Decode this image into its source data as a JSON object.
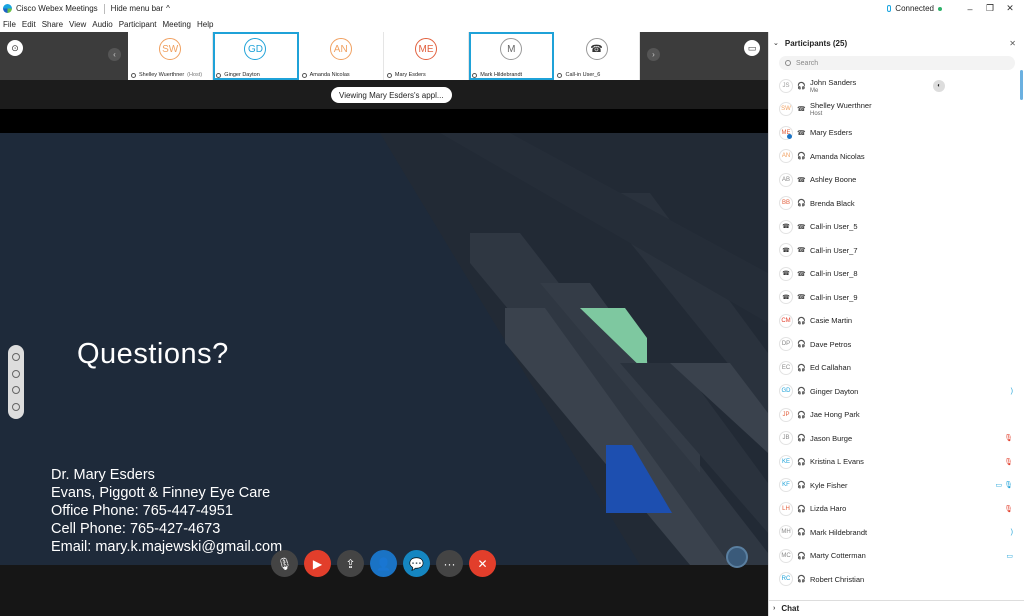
{
  "window": {
    "title": "Cisco Webex Meetings",
    "hide_menu": "Hide menu bar",
    "hide_menu_arrow": "^",
    "status": "Connected",
    "btn_min": "–",
    "btn_max": "❐",
    "btn_close": "✕"
  },
  "menu": [
    "File",
    "Edit",
    "Share",
    "View",
    "Audio",
    "Participant",
    "Meeting",
    "Help"
  ],
  "filmstrip": [
    {
      "initials": "SW",
      "name": "Shelley Wuerthner",
      "tag": "(Host)",
      "color": "#f0a060",
      "active": false,
      "phone": false
    },
    {
      "initials": "GD",
      "name": "Ginger Dayton",
      "tag": "",
      "color": "#1fa2d8",
      "active": true,
      "phone": false
    },
    {
      "initials": "AN",
      "name": "Amanda Nicolas",
      "tag": "",
      "color": "#f0a060",
      "active": false,
      "phone": false
    },
    {
      "initials": "ME",
      "name": "Mary Esders",
      "tag": "",
      "color": "#e2603e",
      "active": false,
      "phone": false
    },
    {
      "initials": "M",
      "name": "Mark Hildebrandt",
      "tag": "",
      "color": "#666666",
      "active": true,
      "phone": false
    },
    {
      "initials": "",
      "name": "Call-in User_6",
      "tag": "",
      "color": "#333333",
      "active": false,
      "phone": true
    }
  ],
  "filmstrip_arrow_left": "‹",
  "filmstrip_arrow_right": "›",
  "viewing_label": "Viewing Mary Esders's appl...",
  "slide": {
    "heading": "Questions?",
    "lines": [
      "Dr. Mary Esders",
      "Evans, Piggott & Finney Eye Care",
      "Office Phone: 765-447-4951",
      "Cell Phone: 765-427-4673",
      "Email: mary.k.majewski@gmail.com"
    ]
  },
  "controls": {
    "mute": "🎙",
    "video": "▶",
    "share": "⇪",
    "participants": "👤",
    "chat": "💬",
    "more": "···",
    "leave": "✕"
  },
  "panel": {
    "title": "Participants (25)",
    "close": "✕",
    "search_placeholder": "Search",
    "chat_label": "Chat",
    "chevron_down": "⌄",
    "chevron_right": "›"
  },
  "participants": [
    {
      "initials": "JS",
      "name": "John Sanders",
      "sub": "Me",
      "color": "#999999",
      "device": "🎧",
      "right": "",
      "right_color": ""
    },
    {
      "initials": "SW",
      "name": "Shelley Wuerthner",
      "sub": "Host",
      "color": "#f0a060",
      "device": "☎",
      "right": "",
      "right_color": ""
    },
    {
      "initials": "ME",
      "name": "Mary Esders",
      "sub": "",
      "color": "#e2603e",
      "device": "☎",
      "right": "",
      "right_color": "",
      "sharing": true
    },
    {
      "initials": "AN",
      "name": "Amanda Nicolas",
      "sub": "",
      "color": "#f0a060",
      "device": "🎧",
      "right": "",
      "right_color": ""
    },
    {
      "initials": "AB",
      "name": "Ashley Boone",
      "sub": "",
      "color": "#888888",
      "device": "☎",
      "right": "",
      "right_color": ""
    },
    {
      "initials": "BB",
      "name": "Brenda Black",
      "sub": "",
      "color": "#e2603e",
      "device": "🎧",
      "right": "",
      "right_color": ""
    },
    {
      "initials": "☎",
      "name": "Call-in User_5",
      "sub": "",
      "color": "#333333",
      "device": "☎",
      "right": "",
      "right_color": ""
    },
    {
      "initials": "☎",
      "name": "Call-in User_7",
      "sub": "",
      "color": "#333333",
      "device": "☎",
      "right": "",
      "right_color": ""
    },
    {
      "initials": "☎",
      "name": "Call-in User_8",
      "sub": "",
      "color": "#333333",
      "device": "☎",
      "right": "",
      "right_color": ""
    },
    {
      "initials": "☎",
      "name": "Call-in User_9",
      "sub": "",
      "color": "#333333",
      "device": "☎",
      "right": "",
      "right_color": ""
    },
    {
      "initials": "CM",
      "name": "Casie Martin",
      "sub": "",
      "color": "#e23e2b",
      "device": "🎧",
      "right": "",
      "right_color": ""
    },
    {
      "initials": "DP",
      "name": "Dave Petros",
      "sub": "",
      "color": "#888888",
      "device": "🎧",
      "right": "",
      "right_color": ""
    },
    {
      "initials": "EC",
      "name": "Ed Callahan",
      "sub": "",
      "color": "#888888",
      "device": "🎧",
      "right": "",
      "right_color": ""
    },
    {
      "initials": "GD",
      "name": "Ginger Dayton",
      "sub": "",
      "color": "#1fa2d8",
      "device": "🎧",
      "right": ")",
      "right_color": "#1fa2d8"
    },
    {
      "initials": "JP",
      "name": "Jae Hong Park",
      "sub": "",
      "color": "#e2603e",
      "device": "🎧",
      "right": "",
      "right_color": ""
    },
    {
      "initials": "JB",
      "name": "Jason Burge",
      "sub": "",
      "color": "#888888",
      "device": "🎧",
      "right": "🎙",
      "right_color": "#e23e2b"
    },
    {
      "initials": "KE",
      "name": "Kristina L Evans",
      "sub": "",
      "color": "#1fa2d8",
      "device": "🎧",
      "right": "🎙",
      "right_color": "#e23e2b"
    },
    {
      "initials": "KF",
      "name": "Kyle Fisher",
      "sub": "",
      "color": "#1fa2d8",
      "device": "🎧",
      "right": "▭ 🎙",
      "right_color": "#1fa2d8"
    },
    {
      "initials": "LH",
      "name": "Lizda Haro",
      "sub": "",
      "color": "#e2603e",
      "device": "🎧",
      "right": "🎙",
      "right_color": "#e23e2b"
    },
    {
      "initials": "MH",
      "name": "Mark Hildebrandt",
      "sub": "",
      "color": "#888888",
      "device": "🎧",
      "right": ")",
      "right_color": "#1fa2d8"
    },
    {
      "initials": "MC",
      "name": "Marty Cotterman",
      "sub": "",
      "color": "#888888",
      "device": "🎧",
      "right": "▭",
      "right_color": "#1fa2d8"
    },
    {
      "initials": "RC",
      "name": "Robert Christian",
      "sub": "",
      "color": "#1fa2d8",
      "device": "🎧",
      "right": "",
      "right_color": ""
    }
  ]
}
